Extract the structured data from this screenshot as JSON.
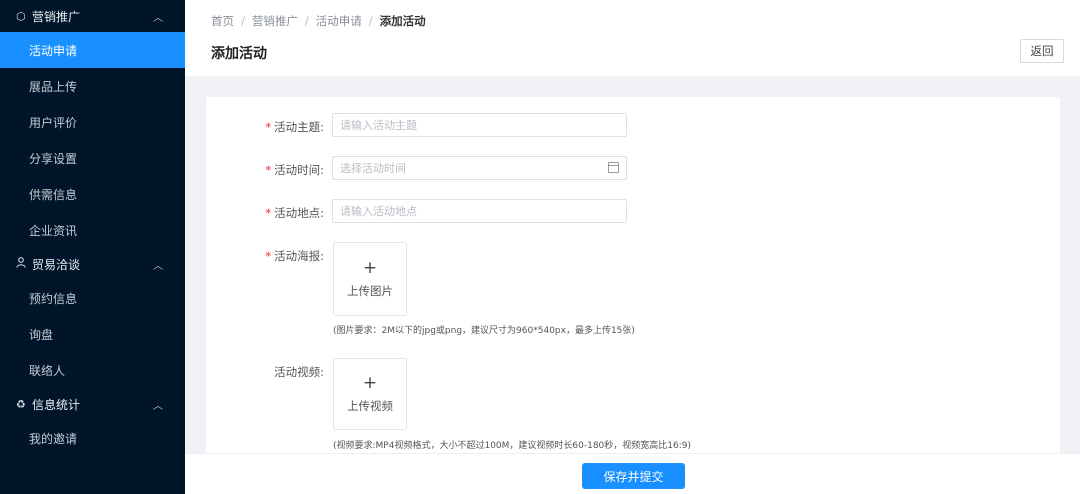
{
  "sidebar": {
    "groups": [
      {
        "label": "营销推广",
        "icon": "cube-icon",
        "items": [
          {
            "label": "活动申请",
            "active": true
          },
          {
            "label": "展品上传"
          },
          {
            "label": "用户评价"
          },
          {
            "label": "分享设置"
          },
          {
            "label": "供需信息"
          },
          {
            "label": "企业资讯"
          }
        ]
      },
      {
        "label": "贸易洽谈",
        "icon": "user-icon",
        "items": [
          {
            "label": "预约信息"
          },
          {
            "label": "询盘"
          },
          {
            "label": "联络人"
          }
        ]
      },
      {
        "label": "信息统计",
        "icon": "recycle-icon",
        "items": [
          {
            "label": "我的邀请"
          }
        ]
      }
    ]
  },
  "breadcrumb": [
    "首页",
    "营销推广",
    "活动申请",
    "添加活动"
  ],
  "header": {
    "title": "添加活动",
    "back_label": "返回"
  },
  "form": {
    "theme": {
      "label": "活动主题:",
      "placeholder": "请输入活动主题"
    },
    "time": {
      "label": "活动时间:",
      "placeholder": "选择活动时间"
    },
    "location": {
      "label": "活动地点:",
      "placeholder": "请输入活动地点"
    },
    "poster": {
      "label": "活动海报:",
      "upload_label": "上传图片",
      "hint": "(图片要求：2M以下的jpg或png，建议尺寸为960*540px，最多上传15张)"
    },
    "video": {
      "label": "活动视频:",
      "upload_label": "上传视频",
      "hint": "(视频要求:MP4视频格式，大小不超过100M，建议视频时长60-180秒，视频宽高比16:9)"
    }
  },
  "footer": {
    "save_label": "保存并提交"
  },
  "colors": {
    "sidebar_bg": "#001529",
    "accent": "#1890ff",
    "required": "#f5222d"
  }
}
